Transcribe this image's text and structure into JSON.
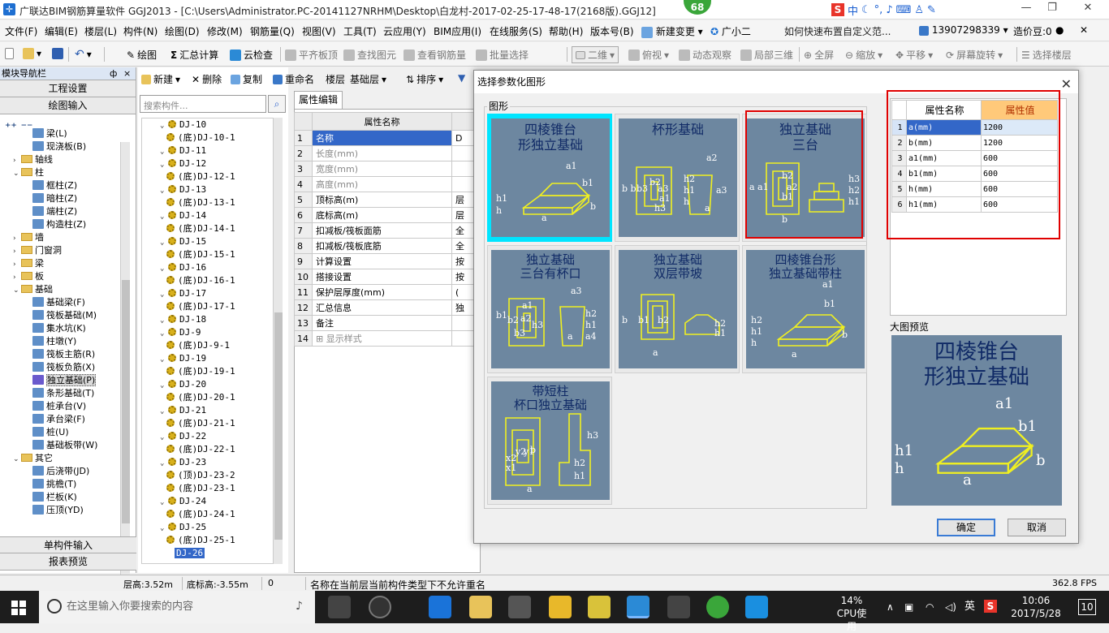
{
  "window": {
    "title": "广联达BIM钢筋算量软件 GGJ2013 - [C:\\Users\\Administrator.PC-20141127NRHM\\Desktop\\白龙村-2017-02-25-17-48-17(2168版).GGJ12]",
    "badge": "68",
    "ime_label": "中"
  },
  "menubar": {
    "items": [
      "文件(F)",
      "编辑(E)",
      "楼层(L)",
      "构件(N)",
      "绘图(D)",
      "修改(M)",
      "钢筋量(Q)",
      "视图(V)",
      "工具(T)",
      "云应用(Y)",
      "BIM应用(I)",
      "在线服务(S)",
      "帮助(H)",
      "版本号(B)"
    ],
    "new_change": "新建变更",
    "assistant": "广小二",
    "help_link": "如何快速布置自定义范...",
    "phone": "13907298339",
    "beans": "造价豆:0"
  },
  "toolbar": {
    "draw": "绘图",
    "sum_calc": "汇总计算",
    "cloud_check": "云检查",
    "flush_board": "平齐板顶",
    "find_elem": "查找图元",
    "view_rebar": "查看钢筋量",
    "batch_select": "批量选择",
    "view_mode": "二维",
    "top_view": "俯视",
    "dynamic_view": "动态观察",
    "local_3d": "局部三维",
    "fullscreen": "全屏",
    "zoom": "缩放",
    "pan": "平移",
    "rotate": "屏幕旋转",
    "select_floor": "选择楼层"
  },
  "nav": {
    "header": "模块导航栏",
    "pin": "ф",
    "btn_project": "工程设置",
    "btn_draw": "绘图输入",
    "btn_single": "单构件输入",
    "btn_report": "报表预览",
    "tree": [
      {
        "label": "梁(L)",
        "type": "leaf",
        "indent": 3
      },
      {
        "label": "现浇板(B)",
        "type": "leaf",
        "indent": 3
      },
      {
        "label": "轴线",
        "type": "folder",
        "indent": 1,
        "exp": ">"
      },
      {
        "label": "柱",
        "type": "folder",
        "indent": 1,
        "exp": "v"
      },
      {
        "label": "框柱(Z)",
        "type": "leaf",
        "indent": 3
      },
      {
        "label": "暗柱(Z)",
        "type": "leaf",
        "indent": 3
      },
      {
        "label": "端柱(Z)",
        "type": "leaf",
        "indent": 3
      },
      {
        "label": "构造柱(Z)",
        "type": "leaf",
        "indent": 3
      },
      {
        "label": "墙",
        "type": "folder",
        "indent": 1,
        "exp": ">"
      },
      {
        "label": "门窗洞",
        "type": "folder",
        "indent": 1,
        "exp": ">"
      },
      {
        "label": "梁",
        "type": "folder",
        "indent": 1,
        "exp": ">"
      },
      {
        "label": "板",
        "type": "folder",
        "indent": 1,
        "exp": ">"
      },
      {
        "label": "基础",
        "type": "folder",
        "indent": 1,
        "exp": "v"
      },
      {
        "label": "基础梁(F)",
        "type": "leaf",
        "indent": 3
      },
      {
        "label": "筏板基础(M)",
        "type": "leaf",
        "indent": 3
      },
      {
        "label": "集水坑(K)",
        "type": "leaf",
        "indent": 3
      },
      {
        "label": "柱墩(Y)",
        "type": "leaf",
        "indent": 3
      },
      {
        "label": "筏板主筋(R)",
        "type": "leaf",
        "indent": 3
      },
      {
        "label": "筏板负筋(X)",
        "type": "leaf",
        "indent": 3
      },
      {
        "label": "独立基础(P)",
        "type": "leaf",
        "indent": 3,
        "selected": true
      },
      {
        "label": "条形基础(T)",
        "type": "leaf",
        "indent": 3
      },
      {
        "label": "桩承台(V)",
        "type": "leaf",
        "indent": 3
      },
      {
        "label": "承台梁(F)",
        "type": "leaf",
        "indent": 3
      },
      {
        "label": "桩(U)",
        "type": "leaf",
        "indent": 3
      },
      {
        "label": "基础板带(W)",
        "type": "leaf",
        "indent": 3
      },
      {
        "label": "其它",
        "type": "folder",
        "indent": 1,
        "exp": "v"
      },
      {
        "label": "后浇带(JD)",
        "type": "leaf",
        "indent": 3
      },
      {
        "label": "挑檐(T)",
        "type": "leaf",
        "indent": 3
      },
      {
        "label": "栏板(K)",
        "type": "leaf",
        "indent": 3
      },
      {
        "label": "压顶(YD)",
        "type": "leaf",
        "indent": 3
      }
    ]
  },
  "component_toolbar": {
    "new": "新建",
    "delete": "删除",
    "copy": "复制",
    "rename": "重命名",
    "floor": "楼层",
    "floor_value": "基础层",
    "sort": "排序"
  },
  "component_list": {
    "search_placeholder": "搜索构件...",
    "items": [
      {
        "label": "DJ-10",
        "level": 0
      },
      {
        "label": "(底)DJ-10-1",
        "level": 1
      },
      {
        "label": "DJ-11",
        "level": 0
      },
      {
        "label": "DJ-12",
        "level": 0
      },
      {
        "label": "(底)DJ-12-1",
        "level": 1
      },
      {
        "label": "DJ-13",
        "level": 0
      },
      {
        "label": "(底)DJ-13-1",
        "level": 1
      },
      {
        "label": "DJ-14",
        "level": 0
      },
      {
        "label": "(底)DJ-14-1",
        "level": 1
      },
      {
        "label": "DJ-15",
        "level": 0
      },
      {
        "label": "(底)DJ-15-1",
        "level": 1
      },
      {
        "label": "DJ-16",
        "level": 0
      },
      {
        "label": "(底)DJ-16-1",
        "level": 1
      },
      {
        "label": "DJ-17",
        "level": 0
      },
      {
        "label": "(底)DJ-17-1",
        "level": 1
      },
      {
        "label": "DJ-18",
        "level": 0
      },
      {
        "label": "DJ-9",
        "level": 0
      },
      {
        "label": "(底)DJ-9-1",
        "level": 1
      },
      {
        "label": "DJ-19",
        "level": 0
      },
      {
        "label": "(底)DJ-19-1",
        "level": 1
      },
      {
        "label": "DJ-20",
        "level": 0
      },
      {
        "label": "(底)DJ-20-1",
        "level": 1
      },
      {
        "label": "DJ-21",
        "level": 0
      },
      {
        "label": "(底)DJ-21-1",
        "level": 1
      },
      {
        "label": "DJ-22",
        "level": 0
      },
      {
        "label": "(底)DJ-22-1",
        "level": 1
      },
      {
        "label": "DJ-23",
        "level": 0
      },
      {
        "label": "(顶)DJ-23-2",
        "level": 1
      },
      {
        "label": "(底)DJ-23-1",
        "level": 1
      },
      {
        "label": "DJ-24",
        "level": 0
      },
      {
        "label": "(底)DJ-24-1",
        "level": 1
      },
      {
        "label": "DJ-25",
        "level": 0
      },
      {
        "label": "(底)DJ-25-1",
        "level": 1
      },
      {
        "label": "DJ-26",
        "level": 0,
        "selected": true
      }
    ]
  },
  "property_editor": {
    "tab": "属性编辑",
    "col_name": "属性名称",
    "rows": [
      {
        "n": "1",
        "name": "名称",
        "val": "D",
        "selected": true
      },
      {
        "n": "2",
        "name": "长度(mm)",
        "val": "",
        "gray": true
      },
      {
        "n": "3",
        "name": "宽度(mm)",
        "val": "",
        "gray": true
      },
      {
        "n": "4",
        "name": "高度(mm)",
        "val": "",
        "gray": true
      },
      {
        "n": "5",
        "name": "顶标高(m)",
        "val": "层"
      },
      {
        "n": "6",
        "name": "底标高(m)",
        "val": "层"
      },
      {
        "n": "7",
        "name": "扣减板/筏板面筋",
        "val": "全"
      },
      {
        "n": "8",
        "name": "扣减板/筏板底筋",
        "val": "全"
      },
      {
        "n": "9",
        "name": "计算设置",
        "val": "按"
      },
      {
        "n": "10",
        "name": "搭接设置",
        "val": "按"
      },
      {
        "n": "11",
        "name": "保护层厚度(mm)",
        "val": "("
      },
      {
        "n": "12",
        "name": "汇总信息",
        "val": "独"
      },
      {
        "n": "13",
        "name": "备注",
        "val": ""
      },
      {
        "n": "14",
        "name": "显示样式",
        "val": "",
        "gray": true,
        "expand": "+"
      }
    ]
  },
  "dialog": {
    "title": "选择参数化图形",
    "group_label": "图形",
    "shapes": [
      {
        "title": "四棱锥台\n形独立基础",
        "labels": [
          "a1",
          "b1",
          "h1",
          "h",
          "a",
          "b"
        ],
        "active": true
      },
      {
        "title": "杯形基础",
        "labels": [
          "a2",
          "b b",
          "b3",
          "b2",
          "a3",
          "a1",
          "h3",
          "h2",
          "h1",
          "h",
          "a3",
          "a"
        ]
      },
      {
        "title": "独立基础\n三台",
        "labels": [
          "a a1",
          "b2",
          "a2",
          "b1",
          "h3",
          "h2",
          "h1",
          "b"
        ],
        "highlighted": true
      },
      {
        "title": "独立基础\n三台有杯口",
        "labels": [
          "a3",
          "a1",
          "b1",
          "a2",
          "b3",
          "b2",
          "h3",
          "h2",
          "h1",
          "a4",
          "a"
        ]
      },
      {
        "title": "独立基础\n双层带坡",
        "labels": [
          "b",
          "b1",
          "b2",
          "a",
          "h2",
          "h1"
        ]
      },
      {
        "title": "四棱锥台形\n独立基础带柱",
        "labels": [
          "a1",
          "b1",
          "h2",
          "h1",
          "h",
          "a",
          "b"
        ]
      },
      {
        "title": "带短柱\n杯口独立基础",
        "labels": [
          "x2",
          "y2",
          "x1",
          "y1",
          "b",
          "h3",
          "h2",
          "h1",
          "a"
        ]
      }
    ],
    "param_header_name": "属性名称",
    "param_header_value": "属性值",
    "params": [
      {
        "n": "1",
        "name": "a(mm)",
        "value": "1200",
        "selected": true
      },
      {
        "n": "2",
        "name": "b(mm)",
        "value": "1200"
      },
      {
        "n": "3",
        "name": "a1(mm)",
        "value": "600"
      },
      {
        "n": "4",
        "name": "b1(mm)",
        "value": "600"
      },
      {
        "n": "5",
        "name": "h(mm)",
        "value": "600"
      },
      {
        "n": "6",
        "name": "h1(mm)",
        "value": "600"
      }
    ],
    "preview_label": "大图预览",
    "preview_title": "四棱锥台\n形独立基础",
    "preview_labels": [
      "a1",
      "b1",
      "h1",
      "h",
      "a",
      "b"
    ],
    "ok": "确定",
    "cancel": "取消"
  },
  "statusbar": {
    "floor_height": "层高:3.52m",
    "bottom_elev": "底标高:-3.55m",
    "zero": "0",
    "message": "名称在当前层当前构件类型下不允许重名",
    "fps": "362.8 FPS"
  },
  "taskbar": {
    "search_placeholder": "在这里输入你要搜索的内容",
    "cpu_percent": "14%",
    "cpu_label": "CPU使用",
    "lang": "英",
    "time": "10:06",
    "date": "2017/5/28",
    "notify_count": "10"
  },
  "colors": {
    "shape_bg": "#6d87a0",
    "active_cyan": "#00e5ff",
    "highlight_red": "#e00000",
    "selection_blue": "#3367c8"
  }
}
